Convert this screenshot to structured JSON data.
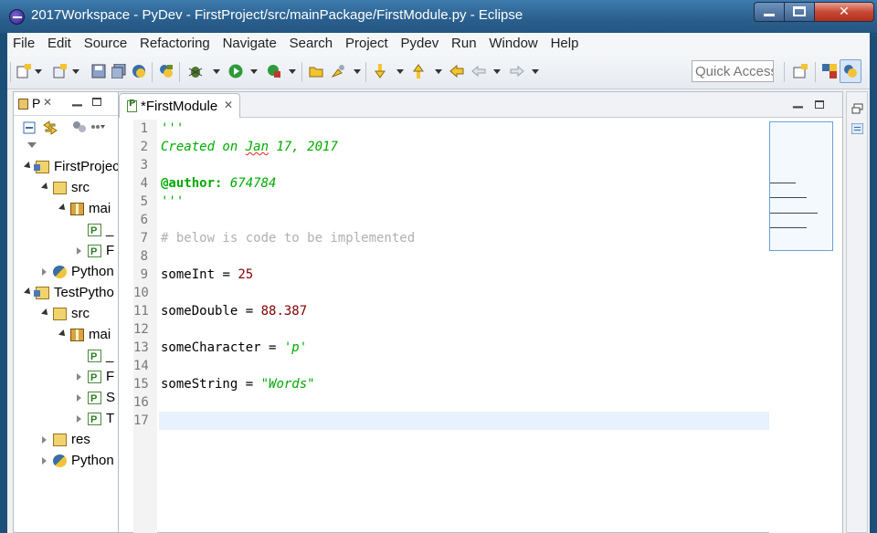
{
  "window": {
    "title": "2017Workspace - PyDev - FirstProject/src/mainPackage/FirstModule.py - Eclipse",
    "minimize_label": "",
    "maximize_label": "",
    "close_label": "✕"
  },
  "menu": [
    "File",
    "Edit",
    "Source",
    "Refactoring",
    "Navigate",
    "Search",
    "Project",
    "Pydev",
    "Run",
    "Window",
    "Help"
  ],
  "toolbar": {
    "quick_access": "Quick Access"
  },
  "explorer": {
    "tab_label": "P",
    "tree": [
      {
        "label": "FirstProjec",
        "icon": "project-icon",
        "level": 0,
        "twisty": "open"
      },
      {
        "label": "src",
        "icon": "source-folder-icon",
        "level": 1,
        "twisty": "open"
      },
      {
        "label": "mai",
        "icon": "package-icon",
        "level": 2,
        "twisty": "open"
      },
      {
        "label": "_",
        "icon": "python-file-icon",
        "level": 3,
        "twisty": "none"
      },
      {
        "label": "F",
        "icon": "python-file-icon",
        "level": 3,
        "twisty": "closed"
      },
      {
        "label": "Python",
        "icon": "python-interpreter-icon",
        "level": 1,
        "twisty": "closed"
      },
      {
        "label": "TestPytho",
        "icon": "project-icon",
        "level": 0,
        "twisty": "open"
      },
      {
        "label": "src",
        "icon": "source-folder-icon",
        "level": 1,
        "twisty": "open"
      },
      {
        "label": "mai",
        "icon": "package-icon",
        "level": 2,
        "twisty": "open"
      },
      {
        "label": "_",
        "icon": "python-file-icon",
        "level": 3,
        "twisty": "none"
      },
      {
        "label": "F",
        "icon": "python-file-icon",
        "level": 3,
        "twisty": "closed"
      },
      {
        "label": "S",
        "icon": "python-file-icon",
        "level": 3,
        "twisty": "closed"
      },
      {
        "label": "T",
        "icon": "python-file-icon",
        "level": 3,
        "twisty": "closed"
      },
      {
        "label": "res",
        "icon": "folder-icon",
        "level": 1,
        "twisty": "closed"
      },
      {
        "label": "Python",
        "icon": "python-interpreter-icon",
        "level": 1,
        "twisty": "closed"
      }
    ]
  },
  "editor": {
    "tab_label": "*FirstModule",
    "current_line": 17,
    "lines": [
      {
        "n": "1",
        "text": "'''"
      },
      {
        "n": "2",
        "text": "Created on Jan 17, 2017"
      },
      {
        "n": "3",
        "text": ""
      },
      {
        "n": "4",
        "text": "@author: 674784"
      },
      {
        "n": "5",
        "text": "'''"
      },
      {
        "n": "6",
        "text": ""
      },
      {
        "n": "7",
        "text": "# below is code to be implemented"
      },
      {
        "n": "8",
        "text": ""
      },
      {
        "n": "9",
        "text": "someInt = 25"
      },
      {
        "n": "10",
        "text": ""
      },
      {
        "n": "11",
        "text": "someDouble = 88.387"
      },
      {
        "n": "12",
        "text": ""
      },
      {
        "n": "13",
        "text": "someCharacter = 'p'"
      },
      {
        "n": "14",
        "text": ""
      },
      {
        "n": "15",
        "text": "someString = \"Words\""
      },
      {
        "n": "16",
        "text": ""
      },
      {
        "n": "17",
        "text": ""
      }
    ]
  },
  "colors": {
    "string": "#00aa00",
    "comment": "#b0b0b0",
    "number": "#800000",
    "current_line": "#e8f2fe"
  }
}
